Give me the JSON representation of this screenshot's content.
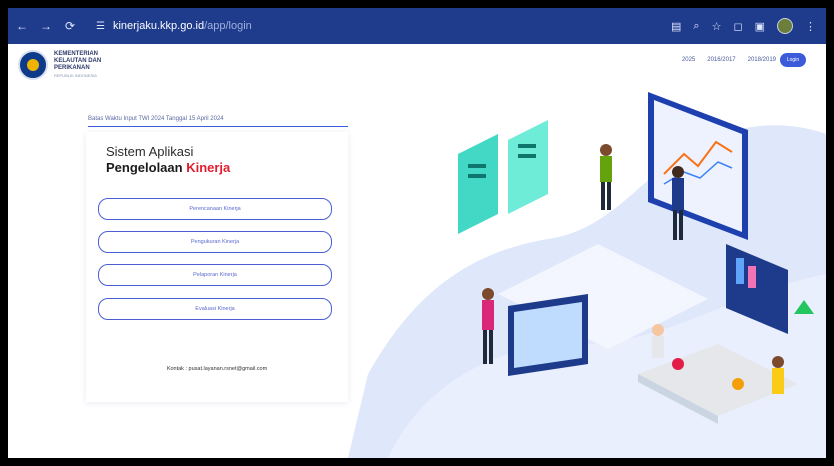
{
  "browser": {
    "url_host": "kinerjaku.kkp.go.id",
    "url_path": "/app/login"
  },
  "header": {
    "logo_lines": [
      "KEMENTERIAN",
      "KELAUTAN DAN",
      "PERIKANAN"
    ],
    "logo_subtitle": "REPUBLIK INDONESIA",
    "years": [
      "2025",
      "2016/2017",
      "2018/2019"
    ],
    "login_label": "Login"
  },
  "main": {
    "deadline_text": "Batas Waktu Input TWI 2024 Tanggal 15 April 2024",
    "title_line1": "Sistem Aplikasi",
    "title_line2_prefix": "Pengelolaan ",
    "title_line2_accent": "Kinerja",
    "menu": [
      {
        "label": "Perencanaan Kinerja"
      },
      {
        "label": "Pengukuran Kinerja"
      },
      {
        "label": "Pelaporan Kinerja"
      },
      {
        "label": "Evaluasi Kinerja"
      }
    ],
    "contact": "Kontak : pusat.layanan.rsnet@gmail.com"
  },
  "colors": {
    "accent": "#3b5bdb",
    "brand_red": "#e11d2e",
    "chrome": "#1f3b8c"
  }
}
